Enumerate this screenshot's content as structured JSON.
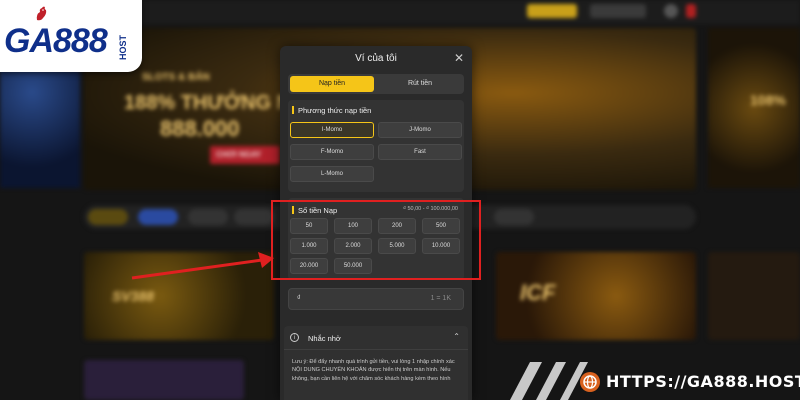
{
  "logo": {
    "brand": "GA888",
    "suffix": "HOST"
  },
  "modal": {
    "title": "Ví của tôi",
    "tabs": {
      "deposit": "Nạp tiền",
      "withdraw": "Rút tiền"
    },
    "payment_section": {
      "title": "Phương thức nạp tiền",
      "methods": [
        "I-Momo",
        "J-Momo",
        "F-Momo",
        "Fast",
        "L-Momo"
      ],
      "selected": "I-Momo"
    },
    "amount_section": {
      "title": "Số tiền Nạp",
      "range": "₫ 50,00 - ₫ 100.000,00",
      "amounts": [
        "50",
        "100",
        "200",
        "500",
        "1.000",
        "2.000",
        "5.000",
        "10.000",
        "20.000",
        "50.000"
      ]
    },
    "amount_input": {
      "currency": "₫",
      "rate": "1 = 1K"
    },
    "reminder": {
      "title": "Nhắc nhở",
      "text": "Lưu ý: Để đẩy nhanh quá trình gửi tiền, vui lòng 1 nhập chính xác NỘI DUNG CHUYỂN KHOẢN được hiển thị trên màn hình. Nếu không, bạn cần liên hệ với chăm sóc khách hàng kèm theo hình"
    }
  },
  "background": {
    "hero_line1": "SLOTS & BẮN",
    "hero_line2": "188% THƯỞNG N",
    "hero_line3": "888.000",
    "hero_button": "CHƠI NGAY",
    "hero_right": "108%",
    "card1": "SV388",
    "card2": "ICF"
  },
  "watermark": {
    "url": "HTTPS://GA888.HOST/"
  },
  "colors": {
    "accent": "#f5c518",
    "highlight": "#e02020",
    "brand": "#0f2f8a"
  }
}
